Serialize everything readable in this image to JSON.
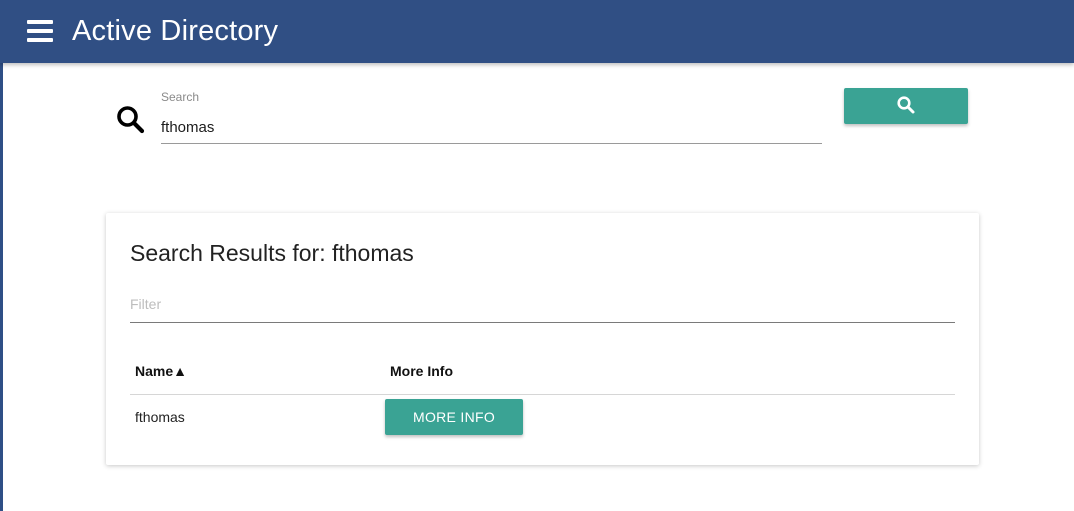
{
  "app": {
    "title": "Active Directory",
    "menu_icon": "hamburger-menu-icon",
    "colors": {
      "header": "#304f84",
      "accent": "#3aa394"
    }
  },
  "search": {
    "label": "Search",
    "value": "fthomas",
    "icon": "search-icon",
    "button_icon": "search-icon"
  },
  "results": {
    "title": "Search Results for: fthomas",
    "filter_placeholder": "Filter",
    "columns": [
      {
        "label": "Name",
        "sort_indicator": "▲"
      },
      {
        "label": "More Info"
      }
    ],
    "rows": [
      {
        "name": "fthomas",
        "action_label": "MORE INFO"
      }
    ]
  }
}
